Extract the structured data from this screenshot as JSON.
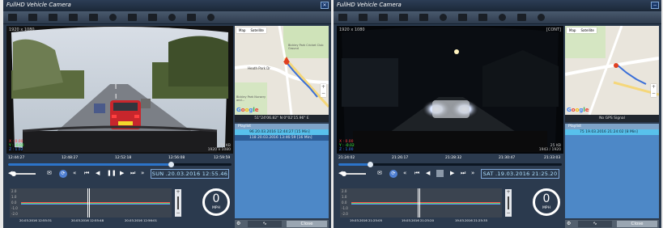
{
  "app1": {
    "title": "FullHD Vehicle Camera",
    "resolution": "1920 x 1080",
    "cont": "",
    "accel": {
      "x": "X : 0.00",
      "y": "Y : -0.02",
      "z": "Z : 1.02"
    },
    "stats": {
      "size": "279 KB",
      "res": "1920 x 1080"
    },
    "gps": "51°24'06.82\" N  0°02'15.96\" E",
    "playlist_header": "Playlist",
    "playlist": [
      {
        "label": "96  20.03.2016 12:44:27 [15 Min]",
        "selected": true
      },
      {
        "label": "118  20.03.2016 13:46:59 [16 Min]",
        "selected": false
      }
    ],
    "ticks": [
      "12:44:27",
      "12:48:27",
      "12:52:18",
      "12:56:08",
      "12:59:59"
    ],
    "progress": 0.73,
    "datetime": "SUN .20.03.2016 12:55.46",
    "graph_times": [
      "20.03.2016 12:55:31",
      "20.03.2016 12:55:48",
      "20.03.2016 12:56:01"
    ],
    "speed": "0",
    "speed_unit": "MPH",
    "close_label": "Close",
    "map": {
      "btn_map": "Map",
      "btn_sat": "Satellite",
      "place1": "Bickley Park Cricket Club Ground",
      "place2": "Heath Park Dr",
      "place3": "Bickley Park Nursery and..."
    }
  },
  "app2": {
    "title": "FullHD Vehicle Camera",
    "resolution": "1920 x 1080",
    "cont": "[CONT]",
    "accel": {
      "x": "X : 0.00",
      "y": "Y : -0.02",
      "z": "Z : 1.00"
    },
    "stats": {
      "size": "25 KB",
      "res": "1943 / 1920"
    },
    "gps": "No GPS Signal",
    "playlist_header": "Playlist",
    "playlist": [
      {
        "label": "75  19.03.2016 21:24:02 [8 Min]",
        "selected": true
      }
    ],
    "ticks": [
      "21:24:02",
      "21:26:17",
      "21:28:32",
      "21:30:47",
      "21:33:03"
    ],
    "progress": 0.14,
    "datetime": "SAT .19.03.2016 21:25.20",
    "graph_times": [
      "19.03.2016 21:25:05",
      "19.03.2016 21:25:20",
      "19.03.2016 21:25:35"
    ],
    "speed": "0",
    "speed_unit": "MPH",
    "close_label": "Close",
    "map": {
      "btn_map": "Map",
      "btn_sat": "Satellite",
      "place1": "",
      "place2": "",
      "place3": ""
    }
  },
  "graph_axis": [
    "2.0",
    "1.0",
    "0.0",
    "-1.0",
    "-2.0"
  ],
  "colors": {
    "accent": "#58c1ec",
    "panel": "#2b3a4e",
    "playlist": "#4d88c7",
    "date_text": "#aee0ff"
  }
}
